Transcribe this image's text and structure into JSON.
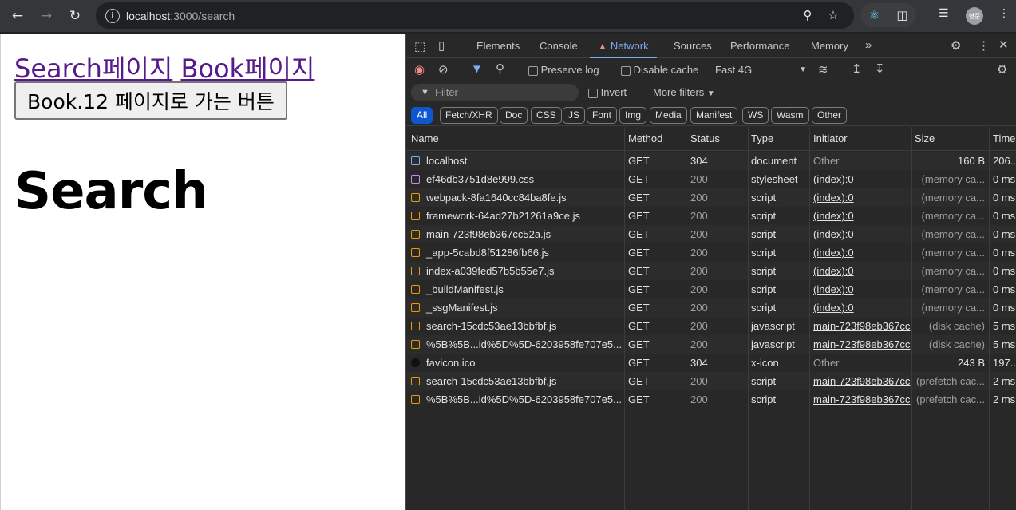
{
  "browser": {
    "url_host": "localhost",
    "url_path": ":3000/search",
    "avatar_label": "형준"
  },
  "page": {
    "link_search": "Search페이지",
    "link_book": "Book페이지",
    "button_label": "Book.12 페이지로 가는 버튼",
    "title": "Search"
  },
  "devtools": {
    "tabs": [
      "Elements",
      "Console",
      "Network",
      "Sources",
      "Performance",
      "Memory"
    ],
    "active_tab": "Network",
    "toolbar": {
      "preserve_log": "Preserve log",
      "disable_cache": "Disable cache",
      "throttle": "Fast 4G"
    },
    "filter": {
      "placeholder": "Filter",
      "invert": "Invert",
      "more_filters": "More filters"
    },
    "chips": [
      "All",
      "Fetch/XHR",
      "Doc",
      "CSS",
      "JS",
      "Font",
      "Img",
      "Media",
      "Manifest",
      "WS",
      "Wasm",
      "Other"
    ],
    "columns": [
      "Name",
      "Method",
      "Status",
      "Type",
      "Initiator",
      "Size",
      "Time"
    ],
    "rows": [
      {
        "name": "localhost",
        "icon": "document-icon",
        "method": "GET",
        "status": "304",
        "type": "document",
        "initiator": "Other",
        "size": "160 B",
        "time": "206..."
      },
      {
        "name": "ef46db3751d8e999.css",
        "icon": "stylesheet-icon",
        "method": "GET",
        "status": "200",
        "type": "stylesheet",
        "initiator": "(index):0",
        "size": "(memory ca...",
        "time": "0 ms"
      },
      {
        "name": "webpack-8fa1640cc84ba8fe.js",
        "icon": "script-icon",
        "method": "GET",
        "status": "200",
        "type": "script",
        "initiator": "(index):0",
        "size": "(memory ca...",
        "time": "0 ms"
      },
      {
        "name": "framework-64ad27b21261a9ce.js",
        "icon": "script-icon",
        "method": "GET",
        "status": "200",
        "type": "script",
        "initiator": "(index):0",
        "size": "(memory ca...",
        "time": "0 ms"
      },
      {
        "name": "main-723f98eb367cc52a.js",
        "icon": "script-icon",
        "method": "GET",
        "status": "200",
        "type": "script",
        "initiator": "(index):0",
        "size": "(memory ca...",
        "time": "0 ms"
      },
      {
        "name": "_app-5cabd8f51286fb66.js",
        "icon": "script-icon",
        "method": "GET",
        "status": "200",
        "type": "script",
        "initiator": "(index):0",
        "size": "(memory ca...",
        "time": "0 ms"
      },
      {
        "name": "index-a039fed57b5b55e7.js",
        "icon": "script-icon",
        "method": "GET",
        "status": "200",
        "type": "script",
        "initiator": "(index):0",
        "size": "(memory ca...",
        "time": "0 ms"
      },
      {
        "name": "_buildManifest.js",
        "icon": "script-icon",
        "method": "GET",
        "status": "200",
        "type": "script",
        "initiator": "(index):0",
        "size": "(memory ca...",
        "time": "0 ms"
      },
      {
        "name": "_ssgManifest.js",
        "icon": "script-icon",
        "method": "GET",
        "status": "200",
        "type": "script",
        "initiator": "(index):0",
        "size": "(memory ca...",
        "time": "0 ms"
      },
      {
        "name": "search-15cdc53ae13bbfbf.js",
        "icon": "script-icon",
        "method": "GET",
        "status": "200",
        "type": "javascript",
        "initiator": "main-723f98eb367cc",
        "size": "(disk cache)",
        "time": "5 ms"
      },
      {
        "name": "%5B%5B...id%5D%5D-6203958fe707e5...",
        "icon": "script-icon",
        "method": "GET",
        "status": "200",
        "type": "javascript",
        "initiator": "main-723f98eb367cc",
        "size": "(disk cache)",
        "time": "5 ms"
      },
      {
        "name": "favicon.ico",
        "icon": "favicon-icon",
        "method": "GET",
        "status": "304",
        "type": "x-icon",
        "initiator": "Other",
        "size": "243 B",
        "time": "197..."
      },
      {
        "name": "search-15cdc53ae13bbfbf.js",
        "icon": "script-icon",
        "method": "GET",
        "status": "200",
        "type": "script",
        "initiator": "main-723f98eb367cc",
        "size": "(prefetch cac...",
        "time": "2 ms"
      },
      {
        "name": "%5B%5B...id%5D%5D-6203958fe707e5...",
        "icon": "script-icon",
        "method": "GET",
        "status": "200",
        "type": "script",
        "initiator": "main-723f98eb367cc",
        "size": "(prefetch cac...",
        "time": "2 ms"
      }
    ]
  }
}
